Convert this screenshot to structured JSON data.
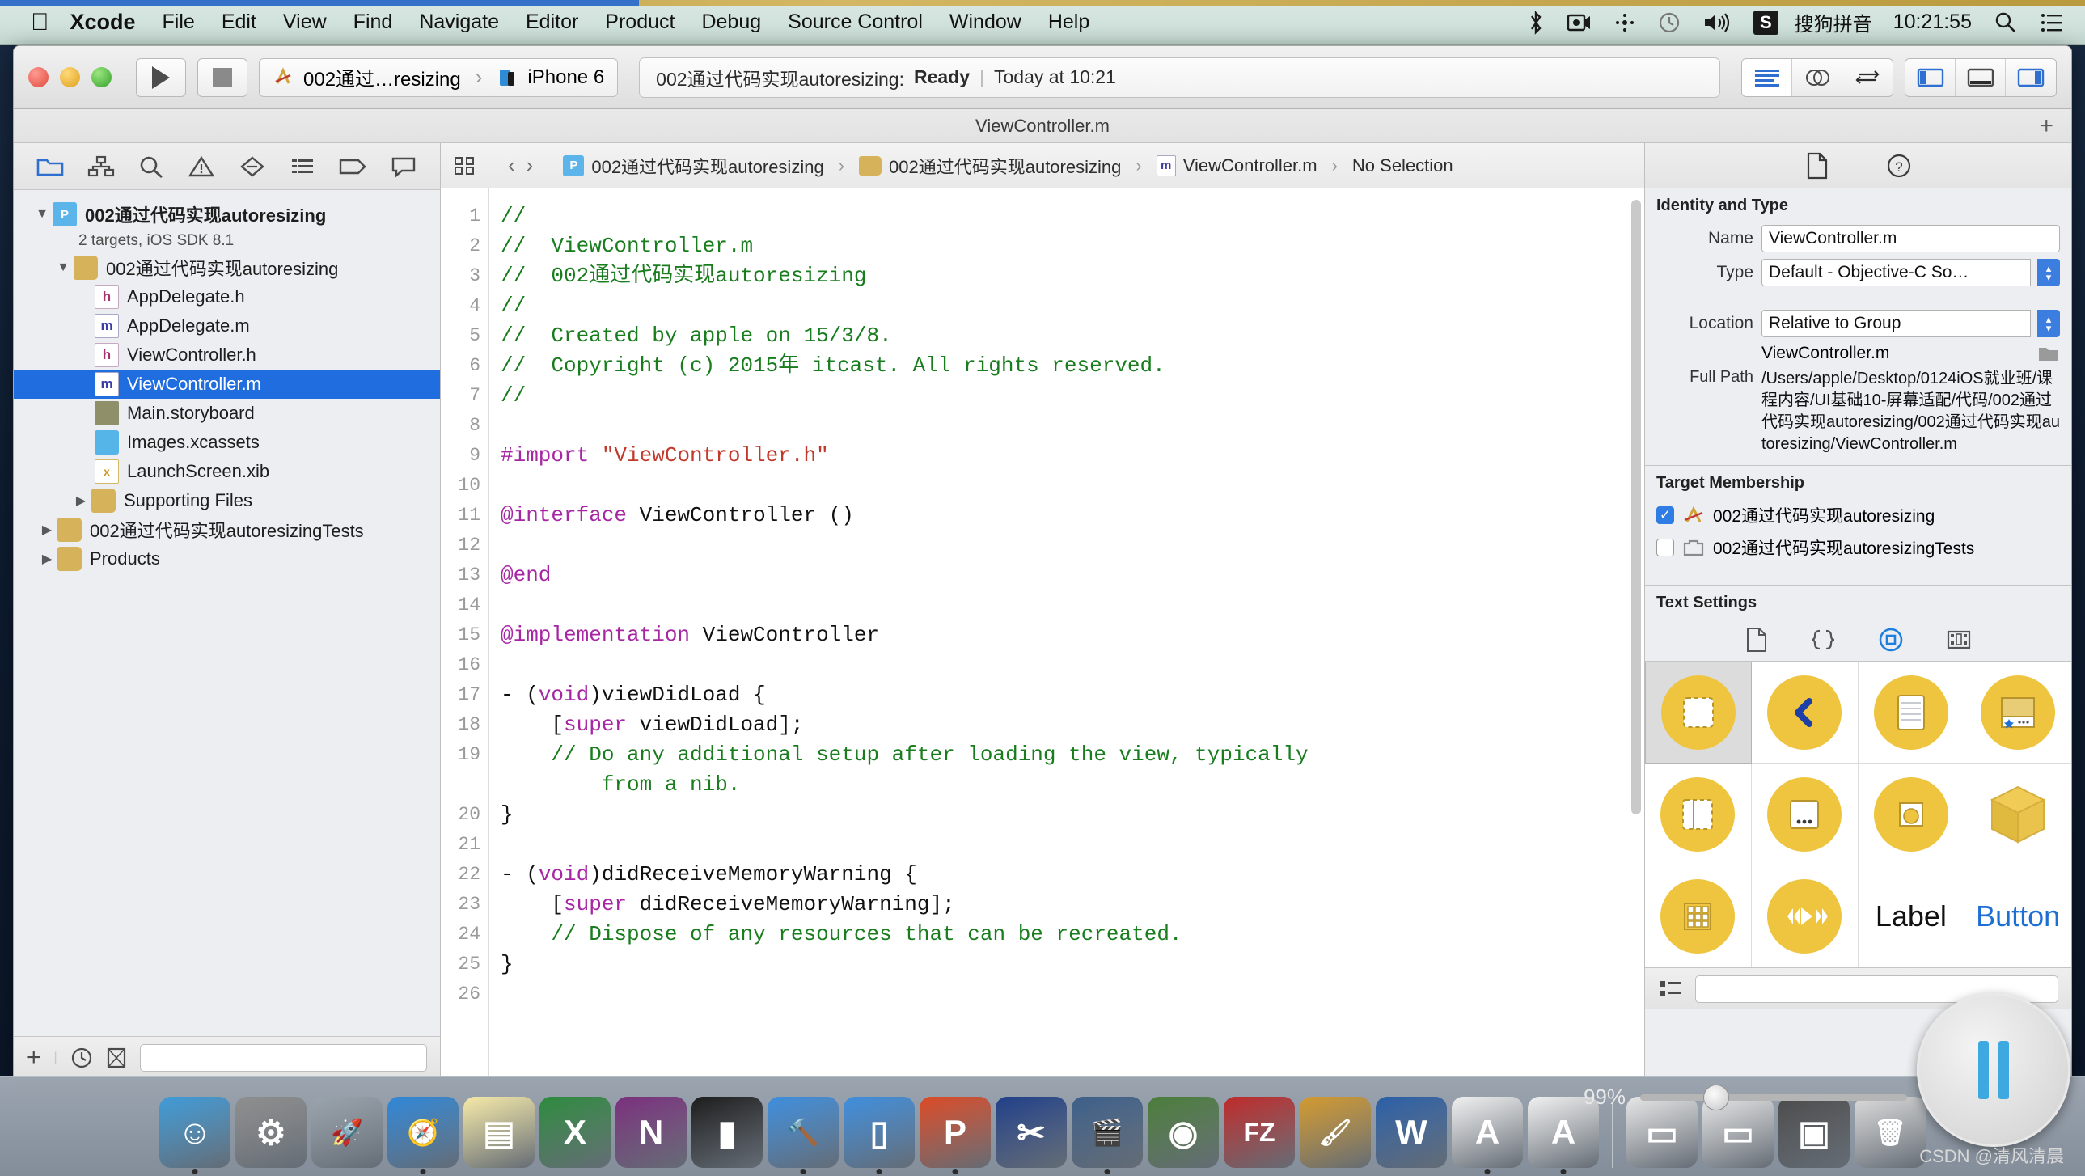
{
  "menubar": {
    "apple_logo": "apple-logo",
    "items": [
      "Xcode",
      "File",
      "Edit",
      "View",
      "Find",
      "Navigate",
      "Editor",
      "Product",
      "Debug",
      "Source Control",
      "Window",
      "Help"
    ],
    "app_name": "Xcode",
    "status_icons": [
      "bluetooth-icon",
      "screen-record-icon",
      "airdrop-icon",
      "time-machine-icon",
      "volume-icon"
    ],
    "input_method_badge": "S",
    "input_method_label": "搜狗拼音",
    "clock": "10:21:55",
    "search_icon": "search-icon",
    "notification_icon": "notification-center-icon"
  },
  "window": {
    "title": "ViewController.m",
    "add_tab_label": "+"
  },
  "toolbar": {
    "run_label": "run-button",
    "stop_label": "stop-button",
    "scheme_project": "002通过…resizing",
    "scheme_device": "iPhone 6",
    "status_project": "002通过代码实现autoresizing:",
    "status_state": "Ready",
    "status_separator": "|",
    "status_time": "Today at 10:21",
    "editor_modes": [
      "standard-editor",
      "assistant-editor",
      "version-editor"
    ],
    "view_toggles": [
      "navigator-toggle",
      "debug-area-toggle",
      "utilities-toggle"
    ]
  },
  "navigator": {
    "tabs": [
      "project-navigator",
      "symbol-navigator",
      "find-navigator",
      "issue-navigator",
      "test-navigator",
      "debug-navigator",
      "breakpoint-navigator",
      "report-navigator"
    ],
    "project": {
      "name": "002通过代码实现autoresizing",
      "subtitle": "2 targets, iOS SDK 8.1"
    },
    "items": [
      {
        "label": "002通过代码实现autoresizing",
        "icon": "folder-icon",
        "indent": 1,
        "twisty": "down",
        "selected": false
      },
      {
        "label": "AppDelegate.h",
        "icon": "header-file-icon",
        "indent": 2,
        "twisty": "",
        "selected": false
      },
      {
        "label": "AppDelegate.m",
        "icon": "objc-file-icon",
        "indent": 2,
        "twisty": "",
        "selected": false
      },
      {
        "label": "ViewController.h",
        "icon": "header-file-icon",
        "indent": 2,
        "twisty": "",
        "selected": false
      },
      {
        "label": "ViewController.m",
        "icon": "objc-file-icon",
        "indent": 2,
        "twisty": "",
        "selected": true
      },
      {
        "label": "Main.storyboard",
        "icon": "storyboard-icon",
        "indent": 2,
        "twisty": "",
        "selected": false
      },
      {
        "label": "Images.xcassets",
        "icon": "assets-icon",
        "indent": 2,
        "twisty": "",
        "selected": false
      },
      {
        "label": "LaunchScreen.xib",
        "icon": "xib-icon",
        "indent": 2,
        "twisty": "",
        "selected": false
      },
      {
        "label": "Supporting Files",
        "icon": "folder-icon",
        "indent": 2,
        "twisty": "right",
        "selected": false
      },
      {
        "label": "002通过代码实现autoresizingTests",
        "icon": "folder-icon",
        "indent": 1,
        "twisty": "right",
        "selected": false
      },
      {
        "label": "Products",
        "icon": "folder-icon",
        "indent": 1,
        "twisty": "right",
        "selected": false
      }
    ],
    "footer": {
      "add_label": "+",
      "recent_icon": "clock-icon",
      "filter_icon": "source-control-filter-icon",
      "filter_placeholder": ""
    }
  },
  "jumpbar": {
    "related_icon": "related-items-icon",
    "back_icon": "back-arrow-icon",
    "forward_icon": "forward-arrow-icon",
    "crumbs": [
      {
        "label": "002通过代码实现autoresizing",
        "icon": "project-icon"
      },
      {
        "label": "002通过代码实现autoresizing",
        "icon": "folder-icon"
      },
      {
        "label": "ViewController.m",
        "icon": "objc-file-icon"
      },
      {
        "label": "No Selection",
        "icon": ""
      }
    ]
  },
  "code": {
    "lines": [
      {
        "n": "1",
        "tokens": [
          {
            "t": "//",
            "c": "cm"
          }
        ]
      },
      {
        "n": "2",
        "tokens": [
          {
            "t": "//  ViewController.m",
            "c": "cm"
          }
        ]
      },
      {
        "n": "3",
        "tokens": [
          {
            "t": "//  002通过代码实现autoresizing",
            "c": "cm"
          }
        ]
      },
      {
        "n": "4",
        "tokens": [
          {
            "t": "//",
            "c": "cm"
          }
        ]
      },
      {
        "n": "5",
        "tokens": [
          {
            "t": "//  Created by apple on 15/3/8.",
            "c": "cm"
          }
        ]
      },
      {
        "n": "6",
        "tokens": [
          {
            "t": "//  Copyright (c) 2015年 itcast. All rights reserved.",
            "c": "cm"
          }
        ]
      },
      {
        "n": "7",
        "tokens": [
          {
            "t": "//",
            "c": "cm"
          }
        ]
      },
      {
        "n": "8",
        "tokens": []
      },
      {
        "n": "9",
        "tokens": [
          {
            "t": "#import ",
            "c": "pp"
          },
          {
            "t": "\"ViewController.h\"",
            "c": "str"
          }
        ]
      },
      {
        "n": "10",
        "tokens": []
      },
      {
        "n": "11",
        "tokens": [
          {
            "t": "@interface ",
            "c": "kw"
          },
          {
            "t": "ViewController ()",
            "c": ""
          }
        ]
      },
      {
        "n": "12",
        "tokens": []
      },
      {
        "n": "13",
        "tokens": [
          {
            "t": "@end",
            "c": "kw"
          }
        ]
      },
      {
        "n": "14",
        "tokens": []
      },
      {
        "n": "15",
        "tokens": [
          {
            "t": "@implementation ",
            "c": "kw"
          },
          {
            "t": "ViewController",
            "c": ""
          }
        ]
      },
      {
        "n": "16",
        "tokens": []
      },
      {
        "n": "17",
        "tokens": [
          {
            "t": "- (",
            "c": ""
          },
          {
            "t": "void",
            "c": "kw"
          },
          {
            "t": ")viewDidLoad {",
            "c": ""
          }
        ]
      },
      {
        "n": "18",
        "tokens": [
          {
            "t": "    [",
            "c": ""
          },
          {
            "t": "super",
            "c": "kw"
          },
          {
            "t": " viewDidLoad];",
            "c": ""
          }
        ]
      },
      {
        "n": "19",
        "tokens": [
          {
            "t": "    // Do any additional setup after loading the view, typically",
            "c": "cm"
          }
        ]
      },
      {
        "n": "",
        "tokens": [
          {
            "t": "        from a nib.",
            "c": "cm"
          }
        ]
      },
      {
        "n": "20",
        "tokens": [
          {
            "t": "}",
            "c": ""
          }
        ]
      },
      {
        "n": "21",
        "tokens": []
      },
      {
        "n": "22",
        "tokens": [
          {
            "t": "- (",
            "c": ""
          },
          {
            "t": "void",
            "c": "kw"
          },
          {
            "t": ")didReceiveMemoryWarning {",
            "c": ""
          }
        ]
      },
      {
        "n": "23",
        "tokens": [
          {
            "t": "    [",
            "c": ""
          },
          {
            "t": "super",
            "c": "kw"
          },
          {
            "t": " didReceiveMemoryWarning];",
            "c": ""
          }
        ]
      },
      {
        "n": "24",
        "tokens": [
          {
            "t": "    // Dispose of any resources that can be recreated.",
            "c": "cm"
          }
        ]
      },
      {
        "n": "25",
        "tokens": [
          {
            "t": "}",
            "c": ""
          }
        ]
      },
      {
        "n": "26",
        "tokens": []
      }
    ]
  },
  "inspector": {
    "tabs": [
      "file-inspector",
      "quick-help-inspector"
    ],
    "identity": {
      "section_title": "Identity and Type",
      "name_label": "Name",
      "name_value": "ViewController.m",
      "type_label": "Type",
      "type_value": "Default - Objective-C So…",
      "location_label": "Location",
      "location_value": "Relative to Group",
      "relative_path": "ViewController.m",
      "fullpath_label": "Full Path",
      "fullpath_value": "/Users/apple/Desktop/0124iOS就业班/课程内容/UI基础10-屏幕适配/代码/002通过代码实现autoresizing/002通过代码实现autoresizing/ViewController.m"
    },
    "target_membership": {
      "section_title": "Target Membership",
      "rows": [
        {
          "label": "002通过代码实现autoresizing",
          "checked": true,
          "icon": "xcode-target-icon"
        },
        {
          "label": "002通过代码实现autoresizingTests",
          "checked": false,
          "icon": "test-target-icon"
        }
      ]
    },
    "text_settings": {
      "section_title": "Text Settings",
      "icons": [
        "file-template-icon",
        "code-snippet-icon",
        "object-library-icon",
        "media-library-icon"
      ]
    },
    "library": {
      "items": [
        {
          "name": "view-object",
          "kind": "icon",
          "selected": true
        },
        {
          "name": "navigation-bar-back-object",
          "kind": "icon",
          "selected": false
        },
        {
          "name": "table-view-object",
          "kind": "icon",
          "selected": false
        },
        {
          "name": "tab-bar-object",
          "kind": "icon",
          "selected": false
        },
        {
          "name": "split-view-object",
          "kind": "icon",
          "selected": false
        },
        {
          "name": "toolbar-object",
          "kind": "icon",
          "selected": false
        },
        {
          "name": "image-view-object",
          "kind": "icon",
          "selected": false
        },
        {
          "name": "container-object",
          "kind": "icon",
          "selected": false
        },
        {
          "name": "collection-view-object",
          "kind": "icon",
          "selected": false
        },
        {
          "name": "player-controls-object",
          "kind": "icon",
          "selected": false
        },
        {
          "name": "label-object",
          "kind": "text",
          "label": "Label",
          "selected": false
        },
        {
          "name": "button-object",
          "kind": "text",
          "label": "Button",
          "selected": false
        }
      ]
    },
    "footer": {
      "list_view_icon": "list-view-icon",
      "search_placeholder": ""
    }
  },
  "dock": {
    "items": [
      {
        "name": "finder",
        "glyph": "☺",
        "color": "#3f9bd8",
        "running": true
      },
      {
        "name": "system-preferences",
        "glyph": "⚙",
        "color": "#8e8e8e",
        "running": false
      },
      {
        "name": "launchpad",
        "glyph": "🚀",
        "color": "#9aa4ad",
        "running": false
      },
      {
        "name": "safari",
        "glyph": "🧭",
        "color": "#2f87d8",
        "running": true
      },
      {
        "name": "notes",
        "glyph": "▤",
        "color": "#f5e9a8",
        "running": false
      },
      {
        "name": "excel",
        "glyph": "X",
        "color": "#2d8a3e",
        "running": false
      },
      {
        "name": "onenote",
        "glyph": "N",
        "color": "#7a2f7d",
        "running": false
      },
      {
        "name": "terminal",
        "glyph": "▮",
        "color": "#1c1c1c",
        "running": false
      },
      {
        "name": "xcode",
        "glyph": "🔨",
        "color": "#3e8ede",
        "running": true
      },
      {
        "name": "xcode-simulator",
        "glyph": "▯",
        "color": "#3e8ede",
        "running": true
      },
      {
        "name": "parallels",
        "glyph": "P",
        "color": "#dc4a26",
        "running": true
      },
      {
        "name": "snipping-tool",
        "glyph": "✂",
        "color": "#1f3f88",
        "running": false
      },
      {
        "name": "quicktime",
        "glyph": "🎬",
        "color": "#3c5f8a",
        "running": true
      },
      {
        "name": "fifo-player",
        "glyph": "◉",
        "color": "#4a7d3a",
        "running": false
      },
      {
        "name": "filezilla",
        "glyph": "FZ",
        "color": "#bf2a2a",
        "running": false
      },
      {
        "name": "photoshop",
        "glyph": "🖌",
        "color": "#d39a2f",
        "running": false
      },
      {
        "name": "word",
        "glyph": "W",
        "color": "#2a5fa8",
        "running": false
      },
      {
        "name": "xcode-doc-1",
        "glyph": "A",
        "color": "#f0f0f0",
        "running": true
      },
      {
        "name": "xcode-doc-2",
        "glyph": "A",
        "color": "#f0f0f0",
        "running": true
      },
      {
        "name": "divider",
        "glyph": "",
        "color": "",
        "running": false
      },
      {
        "name": "downloads-stack",
        "glyph": "▭",
        "color": "#e6e6e6",
        "running": false
      },
      {
        "name": "documents-stack",
        "glyph": "▭",
        "color": "#e6e6e6",
        "running": false
      },
      {
        "name": "screenshot-stack",
        "glyph": "▣",
        "color": "#4b4b4b",
        "running": false
      },
      {
        "name": "trash",
        "glyph": "🗑",
        "color": "#dadada",
        "running": false
      }
    ]
  },
  "overlays": {
    "brightness_value": "99%",
    "watermark": "CSDN @清风清晨"
  }
}
